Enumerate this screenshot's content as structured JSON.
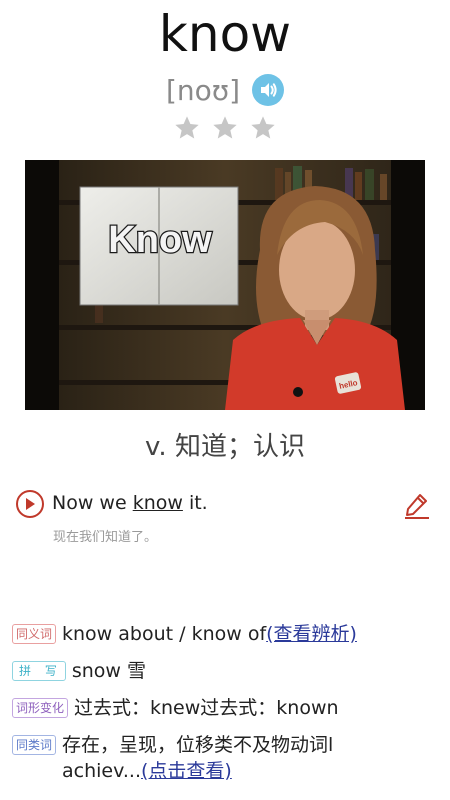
{
  "word": "know",
  "phonetic": "[noʊ]",
  "icons": {
    "speaker": "speaker-icon",
    "star": "star-icon",
    "play": "play-icon",
    "edit": "pencil-icon"
  },
  "rating": {
    "stars_total": 3,
    "stars_filled": 0
  },
  "video": {
    "book_text": "Know",
    "shirt_logo": "hello"
  },
  "definition": "v. 知道；认识",
  "example": {
    "before": "Now we ",
    "word": "know",
    "after": " it.",
    "translation": "现在我们知道了。"
  },
  "synonym": {
    "tag": "同义词",
    "text": "know about / know of",
    "link": "(查看辨析)"
  },
  "spelling": {
    "tag": "拼 写",
    "text": "snow 雪"
  },
  "forms": {
    "tag": "词形变化",
    "text": "过去式：knew过去式：known"
  },
  "similar": {
    "tag": "同类词",
    "line1": "存在，呈现，位移类不及物动词l",
    "line2": "achiev...",
    "link": "(点击查看)"
  },
  "colors": {
    "accent_red": "#c0392b",
    "speaker_blue": "#6ec2e6",
    "link_blue": "#2b3a9a"
  }
}
